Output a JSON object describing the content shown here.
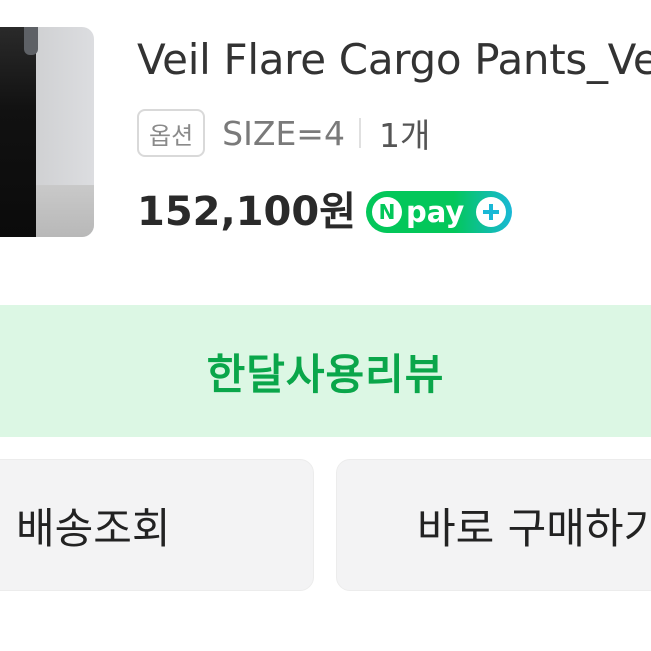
{
  "product": {
    "title": "Veil Flare Cargo Pants_Veil",
    "option_badge": "옵션",
    "option_value": "SIZE=4",
    "quantity": "1개",
    "price": "152,100원",
    "npay": {
      "n": "N",
      "label": "pay"
    }
  },
  "actions": {
    "review": "한달사용리뷰",
    "track_delivery": "배송조회",
    "buy_again": "바로 구매하기"
  },
  "colors": {
    "review_bg": "#dcf7e4",
    "review_text": "#0aa64a",
    "npay_green": "#03c75a"
  }
}
